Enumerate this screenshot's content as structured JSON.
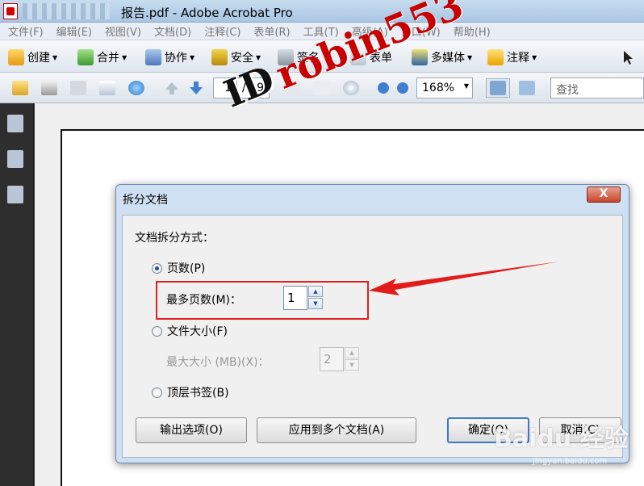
{
  "window": {
    "title": "报告.pdf - Adobe Acrobat Pro"
  },
  "menu": [
    "文件(F)",
    "编辑(E)",
    "视图(V)",
    "文档(D)",
    "注释(C)",
    "表单(R)",
    "工具(T)",
    "高级(A)",
    "窗口(W)",
    "帮助(H)"
  ],
  "tasks_toolbar": [
    {
      "label": "创建",
      "icon": "create-icon"
    },
    {
      "label": "合并",
      "icon": "combine-icon"
    },
    {
      "label": "协作",
      "icon": "collaborate-icon"
    },
    {
      "label": "安全",
      "icon": "lock-icon"
    },
    {
      "label": "签名",
      "icon": "pen-icon"
    },
    {
      "label": "表单",
      "icon": "form-icon"
    },
    {
      "label": "多媒体",
      "icon": "multimedia-icon"
    },
    {
      "label": "注释",
      "icon": "comment-icon"
    }
  ],
  "nav_toolbar": {
    "page_current": "1",
    "page_total": "/ 19",
    "zoom": "168%",
    "search_placeholder": "查找"
  },
  "dialog": {
    "title": "拆分文档",
    "close_label": "X",
    "section_label": "文档拆分方式：",
    "options": [
      {
        "label": "页数(P)",
        "selected": true
      },
      {
        "label": "文件大小(F)",
        "selected": false
      },
      {
        "label": "顶层书签(B)",
        "selected": false
      }
    ],
    "max_pages_label": "最多页数(M)：",
    "max_pages_value": "1",
    "max_size_label": "最大大小 (MB)(X)：",
    "max_size_value": "2",
    "buttons": {
      "output_options": "输出选项(O)",
      "apply_multiple": "应用到多个文档(A)",
      "ok": "确定(O)",
      "cancel": "取消(C)"
    }
  },
  "watermark": {
    "id_text": "ID",
    "robin_text": "robin553",
    "baidu_text": "Baidu 经验",
    "baidu_sub": "jingyan.baidu.com"
  },
  "colors": {
    "accent_red": "#e02020",
    "dialog_frame": "#cfe0f2"
  }
}
